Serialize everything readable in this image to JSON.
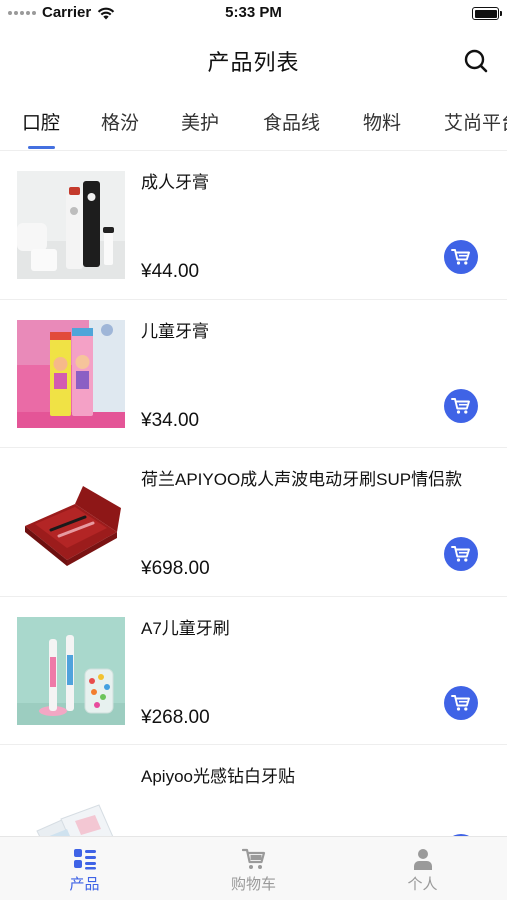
{
  "status_bar": {
    "carrier": "Carrier",
    "time": "5:33 PM"
  },
  "nav": {
    "title": "产品列表",
    "search_icon": "search-icon"
  },
  "tabs": [
    {
      "label": "口腔",
      "active": true
    },
    {
      "label": "格汾",
      "active": false
    },
    {
      "label": "美护",
      "active": false
    },
    {
      "label": "食品线",
      "active": false
    },
    {
      "label": "物料",
      "active": false
    },
    {
      "label": "艾尚平台",
      "active": false
    }
  ],
  "products": [
    {
      "name": "成人牙膏",
      "price": "¥44.00"
    },
    {
      "name": "儿童牙膏",
      "price": "¥34.00"
    },
    {
      "name": "荷兰APIYOO成人声波电动牙刷SUP情侣款",
      "price": "¥698.00"
    },
    {
      "name": "A7儿童牙刷",
      "price": "¥268.00"
    },
    {
      "name": "Apiyoo光感钻白牙贴",
      "price": ""
    }
  ],
  "tab_bar": [
    {
      "label": "产品",
      "icon": "product-list-icon",
      "active": true
    },
    {
      "label": "购物车",
      "icon": "cart-icon",
      "active": false
    },
    {
      "label": "个人",
      "icon": "person-icon",
      "active": false
    }
  ],
  "colors": {
    "accent": "#3f63e6",
    "tab_underline": "#4470e0",
    "divider": "#eeeeee",
    "tab_bar_bg": "#f8f8f8"
  }
}
